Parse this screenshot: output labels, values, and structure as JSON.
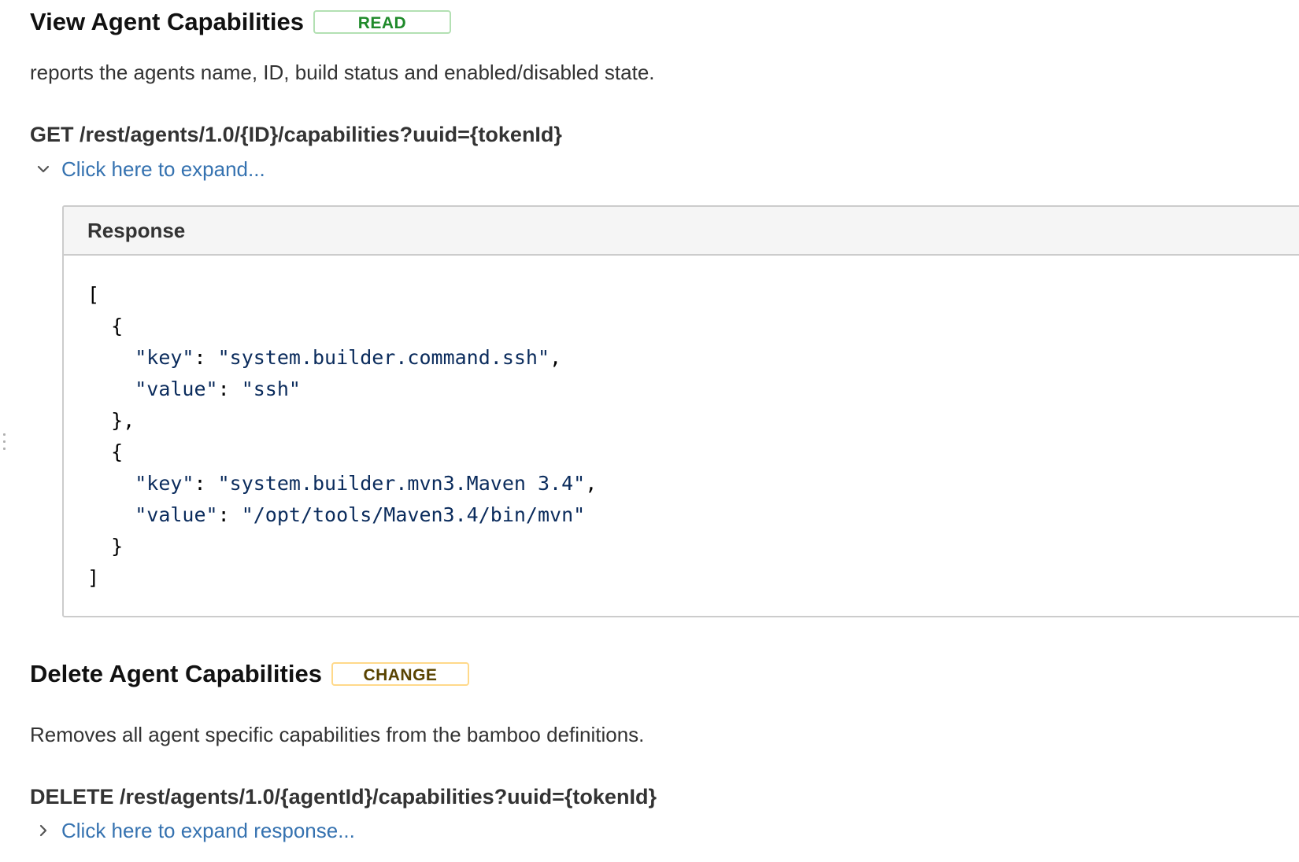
{
  "view_section": {
    "title": "View Agent Capabilities",
    "badge": "READ",
    "description": "reports the agents name, ID, build status and enabled/disabled state.",
    "endpoint": "GET /rest/agents/1.0/{ID}/capabilities?uuid={tokenId}",
    "expand_link": "Click here to expand...",
    "expand_icon": "chevron-down-icon",
    "response": {
      "title": "Response",
      "open_bracket": "[",
      "close_bracket": "]",
      "open_brace": "{",
      "close_brace_comma": "},",
      "close_brace": "}",
      "items": [
        {
          "key_label": "\"key\"",
          "key_value": "\"system.builder.command.ssh\"",
          "value_label": "\"value\"",
          "value_value": "\"ssh\""
        },
        {
          "key_label": "\"key\"",
          "key_value": "\"system.builder.mvn3.Maven 3.4\"",
          "value_label": "\"value\"",
          "value_value": "\"/opt/tools/Maven3.4/bin/mvn\""
        }
      ]
    }
  },
  "delete_section": {
    "title": "Delete Agent Capabilities",
    "badge": "CHANGE",
    "description": "Removes all agent specific capabilities from the bamboo definitions.",
    "endpoint": "DELETE /rest/agents/1.0/{agentId}/capabilities?uuid={tokenId}",
    "expand_link": "Click here to expand response...",
    "expand_icon": "chevron-right-icon"
  },
  "colors": {
    "link": "#3572b0",
    "read_badge_text": "#1f8a2a",
    "read_badge_border": "#b3e0b3",
    "change_badge_text": "#594300",
    "change_badge_border": "#ffd98a"
  }
}
